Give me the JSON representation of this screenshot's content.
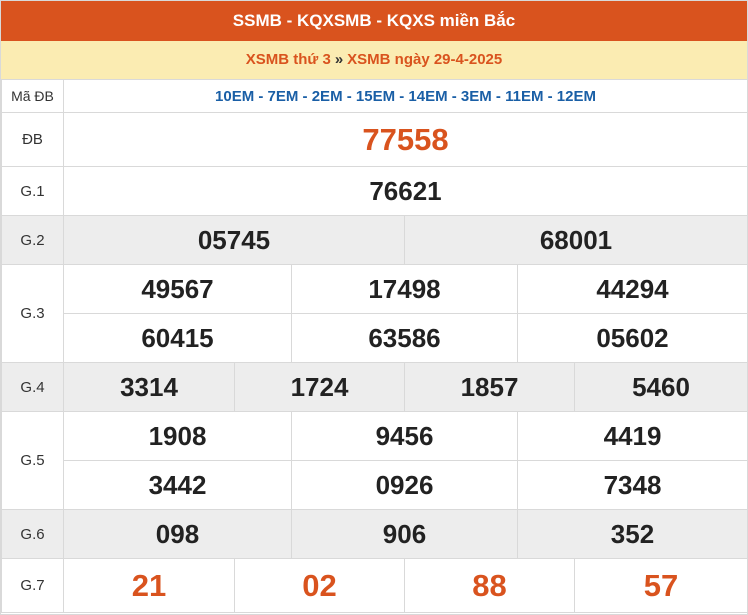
{
  "header": {
    "title": "SSMB - KQXSMB - KQXS miền Bắc",
    "breadcrumb_link1": "XSMB thứ 3",
    "breadcrumb_sep": "»",
    "breadcrumb_link2": "XSMB ngày 29-4-2025"
  },
  "ma_db": {
    "label": "Mã ĐB",
    "value": "10EM - 7EM - 2EM - 15EM - 14EM - 3EM - 11EM - 12EM"
  },
  "prizes": {
    "db": {
      "label": "ĐB",
      "values": [
        "77558"
      ]
    },
    "g1": {
      "label": "G.1",
      "values": [
        "76621"
      ]
    },
    "g2": {
      "label": "G.2",
      "values": [
        "05745",
        "68001"
      ]
    },
    "g3": {
      "label": "G.3",
      "values": [
        "49567",
        "17498",
        "44294",
        "60415",
        "63586",
        "05602"
      ]
    },
    "g4": {
      "label": "G.4",
      "values": [
        "3314",
        "1724",
        "1857",
        "5460"
      ]
    },
    "g5": {
      "label": "G.5",
      "values": [
        "1908",
        "9456",
        "4419",
        "3442",
        "0926",
        "7348"
      ]
    },
    "g6": {
      "label": "G.6",
      "values": [
        "098",
        "906",
        "352"
      ]
    },
    "g7": {
      "label": "G.7",
      "values": [
        "21",
        "02",
        "88",
        "57"
      ]
    }
  },
  "colors": {
    "accent": "#d9531e",
    "highlight_bg": "#fbecb2",
    "row_gray": "#ededed",
    "code_blue": "#1a5fa6"
  }
}
